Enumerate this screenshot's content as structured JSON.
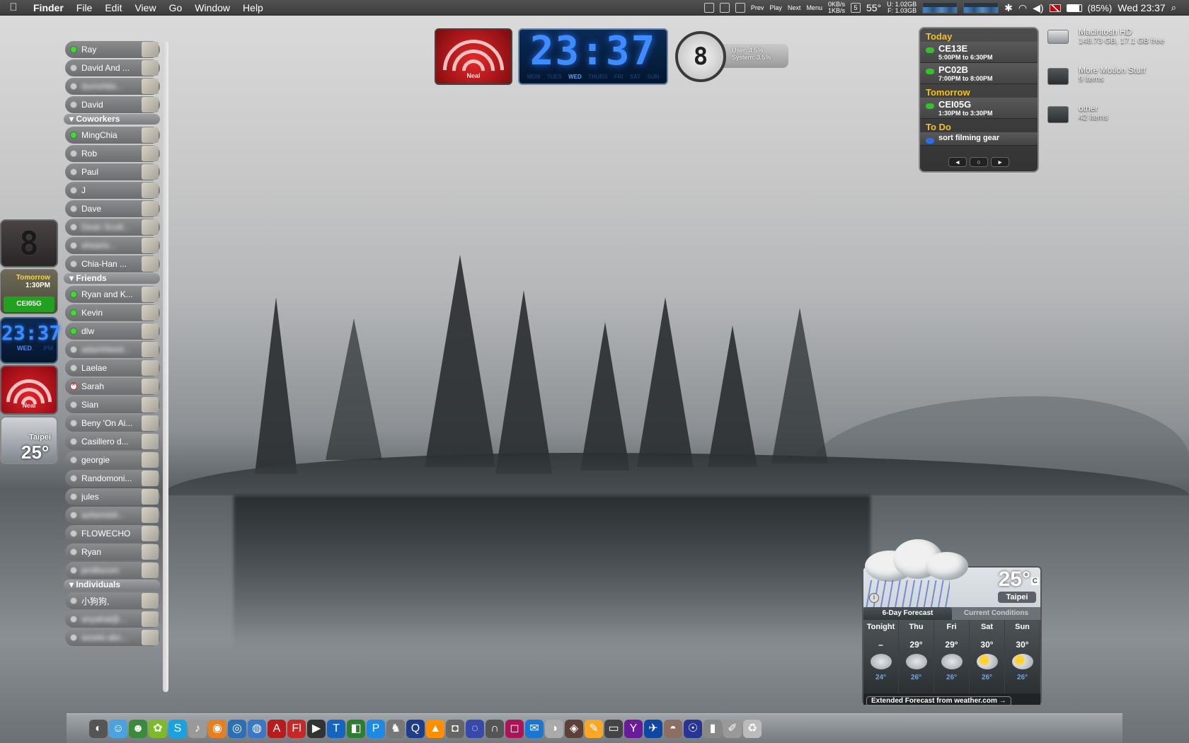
{
  "menubar": {
    "apple_icon": "",
    "items": [
      "Finder",
      "File",
      "Edit",
      "View",
      "Go",
      "Window",
      "Help"
    ],
    "media": {
      "prev": "Prev",
      "play": "Play",
      "next": "Next",
      "menu": "Menu"
    },
    "net_up": "0KB/s",
    "net_down": "1KB/s",
    "cal_day": "5",
    "temperature": "55°",
    "mem_used": "U: 1.02GB",
    "mem_free": "F: 1.03GB",
    "battery": "(85%)",
    "clock": "Wed 23:37"
  },
  "buddies": {
    "groups": {
      "coworkers": "Coworkers",
      "friends": "Friends",
      "individuals": "Individuals"
    },
    "top": [
      {
        "name": "Ray",
        "status": "on"
      },
      {
        "name": "David And ...",
        "status": "off"
      },
      {
        "name": "dumshita...",
        "status": "off",
        "blur": true
      },
      {
        "name": "David",
        "status": "off"
      }
    ],
    "coworkers": [
      {
        "name": "MingChia",
        "status": "on"
      },
      {
        "name": "Rob",
        "status": "off"
      },
      {
        "name": "Paul",
        "status": "off"
      },
      {
        "name": "J",
        "status": "off"
      },
      {
        "name": "Dave",
        "status": "off"
      },
      {
        "name": "Dean Scott...",
        "status": "off",
        "blur": true
      },
      {
        "name": "ehearis...",
        "status": "off",
        "blur": true
      },
      {
        "name": "Chia-Han ...",
        "status": "off"
      }
    ],
    "friends": [
      {
        "name": "Ryan and K...",
        "status": "on"
      },
      {
        "name": "Kevin",
        "status": "on"
      },
      {
        "name": "dlw",
        "status": "on"
      },
      {
        "name": "adamhleed...",
        "status": "off",
        "blur": true
      },
      {
        "name": "Laelae",
        "status": "off"
      },
      {
        "name": "Sarah",
        "status": "x"
      },
      {
        "name": "Sian",
        "status": "off"
      },
      {
        "name": "Beny 'On Ai...",
        "status": "off"
      },
      {
        "name": "Casillero d...",
        "status": "off"
      },
      {
        "name": "georgie",
        "status": "off"
      },
      {
        "name": "Randomoni...",
        "status": "off"
      },
      {
        "name": "jules",
        "status": "off"
      },
      {
        "name": "aohemish...",
        "status": "off",
        "blur": true
      },
      {
        "name": "FLOWECHO",
        "status": "off"
      },
      {
        "name": "Ryan",
        "status": "off"
      },
      {
        "name": "jenillocom",
        "status": "off",
        "blur": true
      }
    ],
    "individuals": [
      {
        "name": "小狗狗,",
        "status": "off"
      },
      {
        "name": "anyahal@...",
        "status": "off",
        "blur": true
      },
      {
        "name": "wowte.abc...",
        "status": "off",
        "blur": true
      }
    ]
  },
  "left_widgets": {
    "seg": "8",
    "ical_label": "Tomorrow",
    "ical_time": "1:30PM",
    "ical_event": "CEI05G",
    "clock": "23:37",
    "clock_day": "WED",
    "clock_ampm": "PM",
    "wifi_name": "Neal",
    "weather_city": "Taipei",
    "weather_temp": "25°"
  },
  "top_widgets": {
    "wifi_name": "Neal",
    "clock": "23:37",
    "days": [
      "MON",
      "TUES",
      "WED",
      "THURS",
      "FRI",
      "SAT",
      "SUN"
    ],
    "active_day": "WED",
    "cpu_digit": "8",
    "cpu_user": "User: 4.5%",
    "cpu_system": "System: 3.5%"
  },
  "ical": {
    "today": "Today",
    "tomorrow": "Tomorrow",
    "todo": "To Do",
    "events_today": [
      {
        "code": "CE13E",
        "time": "5:00PM to 6:30PM"
      },
      {
        "code": "PC02B",
        "time": "7:00PM to 8:00PM"
      }
    ],
    "events_tomorrow": [
      {
        "code": "CEI05G",
        "time": "1:30PM to 3:30PM"
      }
    ],
    "todo_item": "sort filming gear"
  },
  "desktop_icons": [
    {
      "name": "Macintosh HD",
      "sub": "148.73 GB, 17.1 GB free"
    },
    {
      "name": "More Motion Stuff",
      "sub": "9 items"
    },
    {
      "name": "other",
      "sub": "42 items"
    }
  ],
  "weather": {
    "temp": "25°",
    "unit": "C",
    "city": "Taipei",
    "tab_forecast": "6-Day Forecast",
    "tab_conditions": "Current Conditions",
    "days": [
      {
        "name": "Tonight",
        "hi": "–",
        "lo": "24°",
        "icon": "rain"
      },
      {
        "name": "Thu",
        "hi": "29°",
        "lo": "26°",
        "icon": "rain"
      },
      {
        "name": "Fri",
        "hi": "29°",
        "lo": "26°",
        "icon": "rain"
      },
      {
        "name": "Sat",
        "hi": "30°",
        "lo": "26°",
        "icon": "sun-rain"
      },
      {
        "name": "Sun",
        "hi": "30°",
        "lo": "26°",
        "icon": "sun-rain"
      }
    ],
    "footer": "Extended Forecast from weather.com →"
  },
  "dock": {
    "items": [
      "dashboard",
      "finder",
      "adium",
      "growl",
      "skype",
      "itunes",
      "firefox",
      "camino",
      "safari",
      "acrobat",
      "flash",
      "imovie",
      "textedit",
      "finalcut",
      "photoshop",
      "chess",
      "quicktime",
      "vlc",
      "camera",
      "ichat",
      "headphones",
      "preview",
      "mail",
      "dvd",
      "istat",
      "stickies",
      "terminal",
      "yahoo",
      "wings",
      "shell",
      "sky",
      "chart",
      "notes",
      "trash"
    ],
    "glyphs": [
      "◐",
      "☺",
      "☻",
      "✿",
      "S",
      "♪",
      "◉",
      "◎",
      "◍",
      "A",
      "Fl",
      "▶",
      "T",
      "◧",
      "P",
      "♞",
      "Q",
      "▲",
      "◘",
      "◌",
      "∩",
      "◻",
      "✉",
      "◑",
      "◈",
      "✎",
      "▭",
      "Y",
      "✈",
      "◓",
      "☉",
      "▮",
      "✐",
      "♻"
    ]
  }
}
